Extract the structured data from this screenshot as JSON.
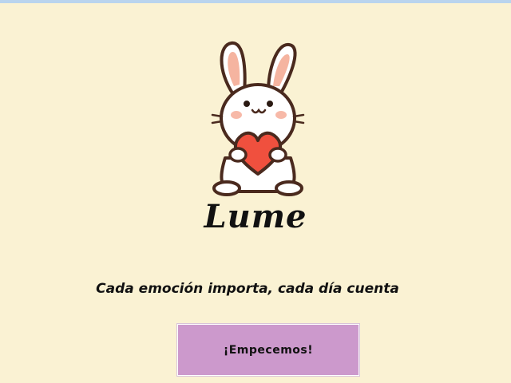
{
  "app": {
    "title": "Lume",
    "tagline": "Cada emoción importa, cada día cuenta",
    "mascot_icon": "bunny-with-heart-icon"
  },
  "actions": {
    "start_label": "¡Empecemos!"
  },
  "colors": {
    "background": "#FAF2D3",
    "top_strip": "#B9D4EE",
    "button": "#CC99CC",
    "heart": "#F0503E",
    "ears_inner": "#F5B4A0",
    "outline": "#4A2A1E"
  }
}
